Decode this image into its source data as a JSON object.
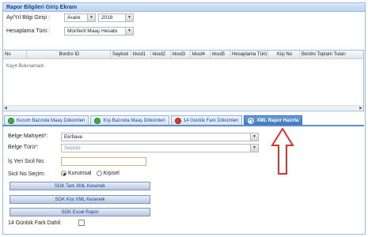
{
  "panel": {
    "title": "Rapor Bilgileri Giriş Ekranı"
  },
  "period": {
    "label": "Ay/Yıl Bilgi Girişi :",
    "month": "Aralık",
    "year": "2018"
  },
  "calc": {
    "label": "Hesaplama Türü :",
    "value": "Münferit Maaş Hesabı"
  },
  "grid": {
    "columns": [
      "No",
      "Bordro ID",
      "Saykod",
      "kkod1",
      "kkod2",
      "kkod3",
      "kkod4",
      "kkod5",
      "Hesaplama Türü",
      "Kişi No",
      "Bordro Toplam Tutarı"
    ],
    "empty_text": "Kayıt Bulunamadı."
  },
  "tabs": [
    {
      "label": "Kurum Bazında Maaş Dökümleri",
      "icon": "green-circle-icon",
      "active": false
    },
    {
      "label": "Kişi Bazında Maaş Dökümleri",
      "icon": "green-circle-icon",
      "active": false
    },
    {
      "label": "14 Günlük Fark Dökümleri",
      "icon": "red-circle-icon",
      "active": false
    },
    {
      "label": "XML Rapor Hazırla",
      "icon": "refresh-icon",
      "active": true
    }
  ],
  "form": {
    "belge_mahiyet_label": "Belge Mahiyeti",
    "belge_mahiyet_value": "Ek/İlave",
    "belge_turu_label": "Belge Türü",
    "belge_turu_placeholder": "Seçiniz",
    "isyeri_label": "İş Yeri Sicil No:",
    "isyeri_value": "",
    "sicil_label": "Sicil No Seçim:",
    "sicil_options": [
      "Kurumsal",
      "Kişisel"
    ],
    "sicil_selected": "Kurumsal",
    "buttons": [
      "SGK Tam XML Kesenek",
      "SGK Kist XML Kesenek",
      "SGK Excel Rapor"
    ],
    "fark_label": "14 Günlük Fark Dahil:",
    "fark_checked": false,
    "required_mark": "*:"
  },
  "annotation": {
    "arrow_color": "#e03030"
  },
  "colors": {
    "accent": "#3f77c1",
    "border": "#99bbe8",
    "header_text": "#15428b"
  }
}
